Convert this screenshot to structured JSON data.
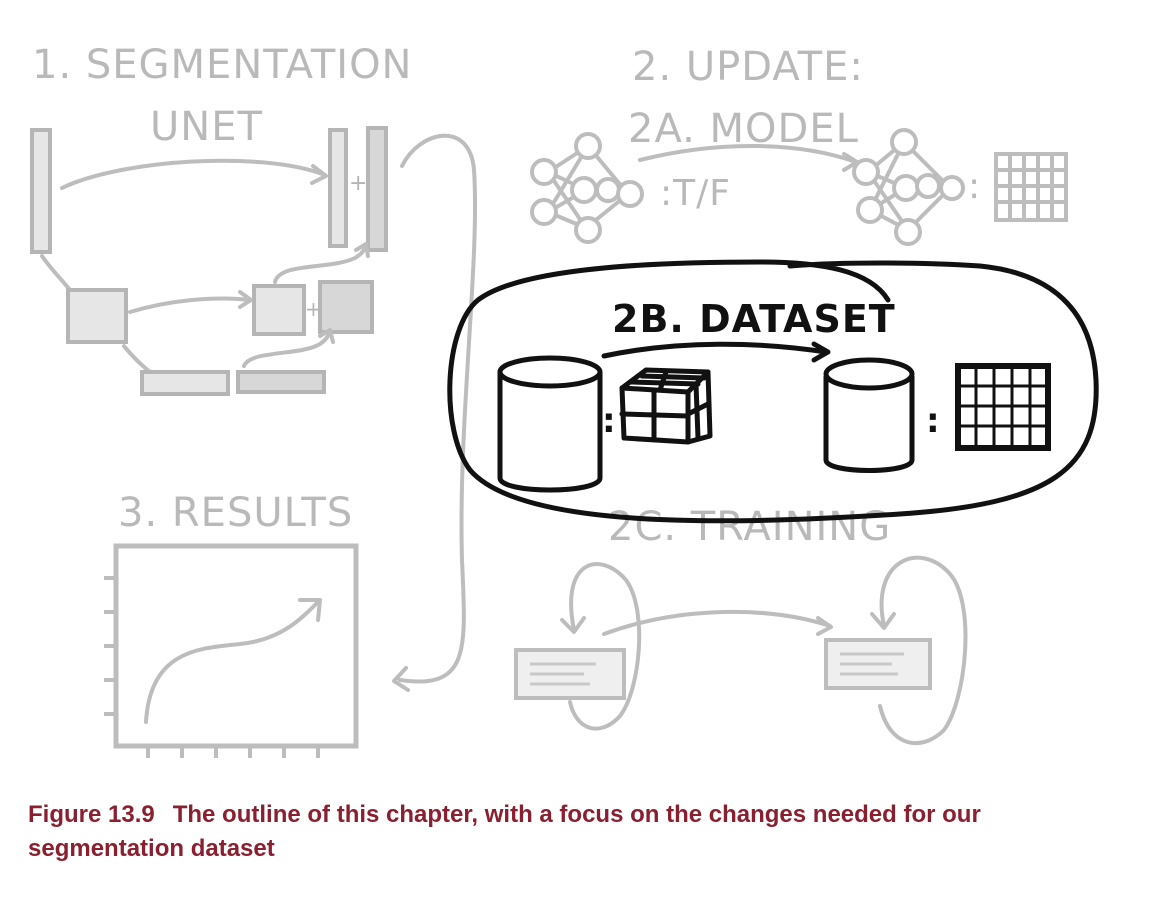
{
  "labels": {
    "segmentation": "1. SEGMENTATION",
    "unet": "UNET",
    "update": "2. UPDATE:",
    "model": "2A. MODEL",
    "tf": ":T/F",
    "dataset": "2B. DATASET",
    "training": "2C. TRAINING",
    "results": "3. RESULTS",
    "plus": "+",
    "colon": ":"
  },
  "caption": {
    "figure_number": "Figure 13.9",
    "text": "The outline of this chapter, with a focus on the changes needed for our segmentation dataset"
  },
  "colors": {
    "faded": "#bdbdbd",
    "focus": "#111111",
    "caption": "#8a1f2f"
  }
}
